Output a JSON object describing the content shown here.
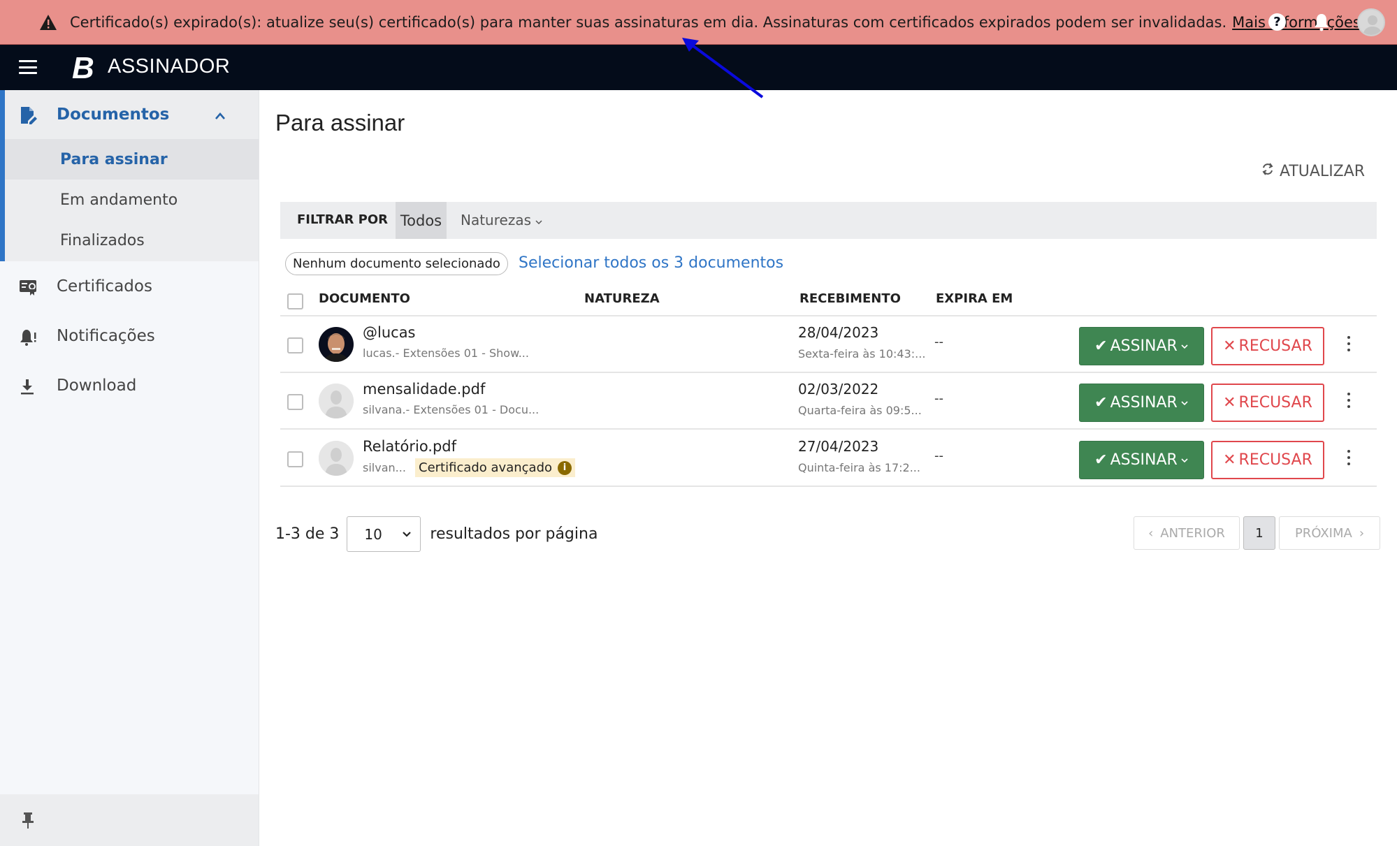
{
  "banner": {
    "icon": "warning-icon",
    "message": "Certificado(s) expirado(s): atualize seu(s) certificado(s) para manter suas assinaturas em dia. Assinaturas com certificados expirados podem ser invalidadas.",
    "link_label": "Mais informações",
    "color": "#e8908b"
  },
  "topbar": {
    "logo_letter": "B",
    "app_name": "ASSINADOR",
    "help_label": "?",
    "icons": [
      "menu-icon",
      "help-icon",
      "bell-icon",
      "avatar"
    ]
  },
  "sidebar": {
    "group": {
      "label": "Documentos",
      "icon": "document-sign-icon",
      "expanded": true,
      "items": [
        {
          "label": "Para assinar",
          "active": true
        },
        {
          "label": "Em andamento",
          "active": false
        },
        {
          "label": "Finalizados",
          "active": false
        }
      ]
    },
    "items": [
      {
        "label": "Certificados",
        "icon": "certificate-icon"
      },
      {
        "label": "Notificações",
        "icon": "bell-alert-icon"
      },
      {
        "label": "Download",
        "icon": "download-icon"
      }
    ],
    "pin_icon": "pin-icon"
  },
  "main": {
    "title": "Para assinar",
    "refresh_label": "ATUALIZAR",
    "filter": {
      "label": "FILTRAR POR",
      "options": [
        "Todos",
        "Naturezas"
      ],
      "selected": "Todos"
    },
    "selection": {
      "status": "Nenhum documento selecionado",
      "select_all_label": "Selecionar todos os 3 documentos"
    },
    "table": {
      "columns": [
        "DOCUMENTO",
        "NATUREZA",
        "RECEBIMENTO",
        "EXPIRA EM"
      ],
      "sign_label": "ASSINAR",
      "refuse_label": "RECUSAR",
      "rows": [
        {
          "name": "@lucas",
          "subtitle": "lucas.- Extensões 01 - Show...",
          "badge": "",
          "natureza": "",
          "date": "28/04/2023",
          "time": "Sexta-feira às 10:43:...",
          "expires": "--",
          "avatar": "photo"
        },
        {
          "name": "mensalidade.pdf",
          "subtitle": "silvana.- Extensões 01 - Docu...",
          "badge": "",
          "natureza": "",
          "date": "02/03/2022",
          "time": "Quarta-feira às 09:5...",
          "expires": "--",
          "avatar": "placeholder"
        },
        {
          "name": "Relatório.pdf",
          "subtitle": "silvan...",
          "badge": "Certificado avançado",
          "natureza": "",
          "date": "27/04/2023",
          "time": "Quinta-feira às 17:2...",
          "expires": "--",
          "avatar": "placeholder"
        }
      ]
    },
    "pagination": {
      "range": "1-3 de 3",
      "per_page": "10",
      "per_page_label": "resultados por página",
      "prev_label": "ANTERIOR",
      "next_label": "PRÓXIMA",
      "current_page": "1"
    }
  },
  "colors": {
    "accent": "#2f75c6",
    "sign": "#3f8652",
    "refuse": "#e0474c",
    "topbar": "#040c1a",
    "annotation_arrow": "#0a0adc"
  }
}
